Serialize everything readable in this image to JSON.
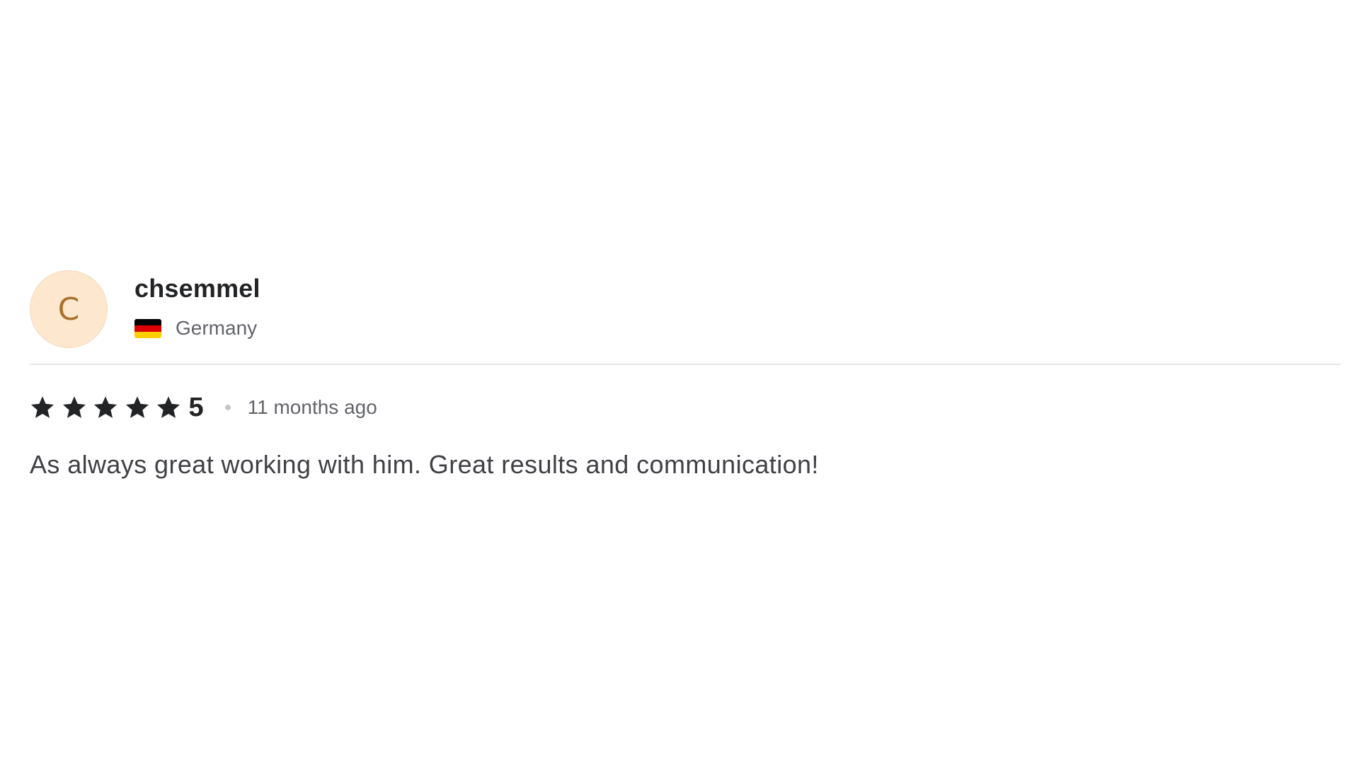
{
  "reviewer": {
    "avatar_initial": "C",
    "username": "chsemmel",
    "country": "Germany",
    "flag_icon": "germany-flag-icon",
    "flag_colors": [
      "#000000",
      "#dd0000",
      "#ffce00"
    ]
  },
  "review": {
    "rating": 5,
    "rating_label": "5",
    "stars_filled": 5,
    "stars_total": 5,
    "time_ago": "11 months ago",
    "text": "As always great working with him. Great results and communication!"
  },
  "colors": {
    "avatar_bg": "#fde8cf",
    "avatar_text": "#a9712c",
    "star": "#222325",
    "divider": "#e4e5e7"
  }
}
